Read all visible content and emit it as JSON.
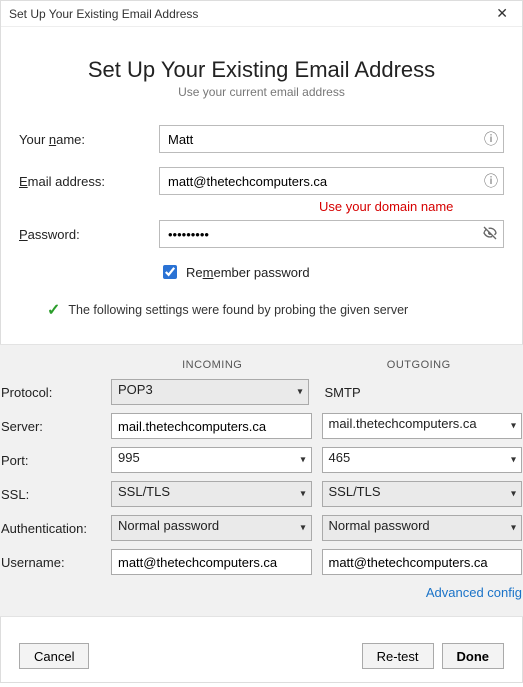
{
  "titlebar": {
    "title": "Set Up Your Existing Email Address"
  },
  "header": {
    "title": "Set Up Your Existing Email Address",
    "subtitle": "Use your current email address"
  },
  "form": {
    "name_label_pre": "Your ",
    "name_label_u": "n",
    "name_label_post": "ame:",
    "name_value": "Matt",
    "email_label_u": "E",
    "email_label_post": "mail address:",
    "email_value": "matt@thetechcomputers.ca",
    "annotation": "Use your domain name",
    "password_label_u": "P",
    "password_label_post": "assword:",
    "password_value": "•••••••••",
    "remember_label_pre": "Re",
    "remember_label_u": "m",
    "remember_label_post": "ember password"
  },
  "status": {
    "text": "The following settings were found by probing the given server"
  },
  "grid": {
    "incoming_header": "INCOMING",
    "outgoing_header": "OUTGOING",
    "protocol_label": "Protocol:",
    "protocol_in": "POP3",
    "protocol_out": "SMTP",
    "server_label": "Server:",
    "server_in": "mail.thetechcomputers.ca",
    "server_out": "mail.thetechcomputers.ca",
    "port_label": "Port:",
    "port_in": "995",
    "port_out": "465",
    "ssl_label": "SSL:",
    "ssl_in": "SSL/TLS",
    "ssl_out": "SSL/TLS",
    "auth_label": "Authentication:",
    "auth_in": "Normal password",
    "auth_out": "Normal password",
    "user_label": "Username:",
    "user_in": "matt@thetechcomputers.ca",
    "user_out": "matt@thetechcomputers.ca",
    "advanced": "Advanced config"
  },
  "buttons": {
    "cancel": "Cancel",
    "retest": "Re-test",
    "done": "Done"
  }
}
